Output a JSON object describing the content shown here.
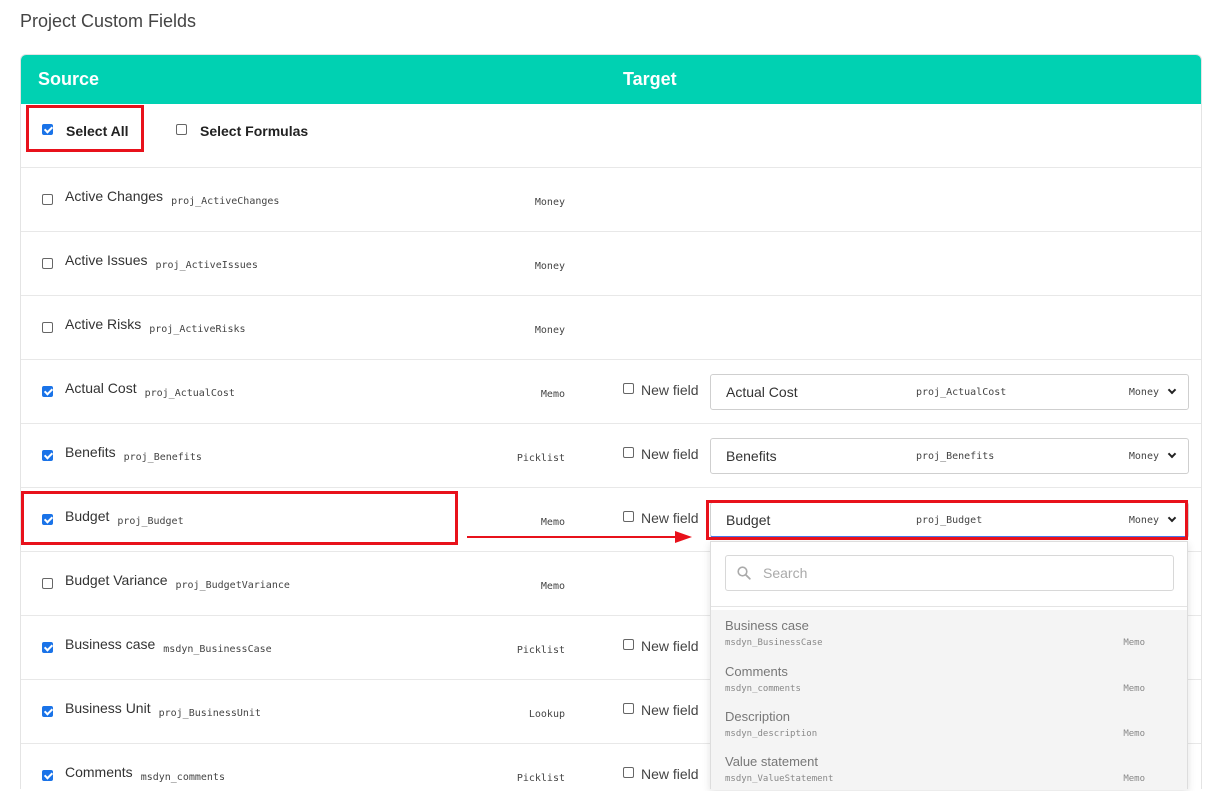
{
  "page": {
    "title": "Project Custom Fields"
  },
  "header": {
    "source": "Source",
    "target": "Target"
  },
  "select_all": {
    "label": "Select All",
    "checked": true
  },
  "select_formulas": {
    "label": "Select Formulas",
    "checked": false
  },
  "new_field_label": "New field",
  "rows": [
    {
      "name": "Active Changes",
      "code": "proj_ActiveChanges",
      "type": "Money",
      "checked": false
    },
    {
      "name": "Active Issues",
      "code": "proj_ActiveIssues",
      "type": "Money",
      "checked": false
    },
    {
      "name": "Active Risks",
      "code": "proj_ActiveRisks",
      "type": "Money",
      "checked": false
    },
    {
      "name": "Actual Cost",
      "code": "proj_ActualCost",
      "type": "Memo",
      "checked": true,
      "target": {
        "name": "Actual Cost",
        "code": "proj_ActualCost",
        "type": "Money"
      }
    },
    {
      "name": "Benefits",
      "code": "proj_Benefits",
      "type": "Picklist",
      "checked": true,
      "target": {
        "name": "Benefits",
        "code": "proj_Benefits",
        "type": "Money"
      }
    },
    {
      "name": "Budget",
      "code": "proj_Budget",
      "type": "Memo",
      "checked": true,
      "target": {
        "name": "Budget",
        "code": "proj_Budget",
        "type": "Money"
      }
    },
    {
      "name": "Budget Variance",
      "code": "proj_BudgetVariance",
      "type": "Memo",
      "checked": false
    },
    {
      "name": "Business case",
      "code": "msdyn_BusinessCase",
      "type": "Picklist",
      "checked": true
    },
    {
      "name": "Business Unit",
      "code": "proj_BusinessUnit",
      "type": "Lookup",
      "checked": true
    },
    {
      "name": "Comments",
      "code": "msdyn_comments",
      "type": "Picklist",
      "checked": true
    }
  ],
  "dropdown": {
    "search_placeholder": "Search",
    "items": [
      {
        "name": "Business case",
        "code": "msdyn_BusinessCase",
        "type": "Memo"
      },
      {
        "name": "Comments",
        "code": "msdyn_comments",
        "type": "Memo"
      },
      {
        "name": "Description",
        "code": "msdyn_description",
        "type": "Memo"
      },
      {
        "name": "Value statement",
        "code": "msdyn_ValueStatement",
        "type": "Memo"
      }
    ]
  },
  "colors": {
    "header": "#00d1b2",
    "checkbox": "#1a73e8",
    "highlight": "#e8111b"
  },
  "icons": {
    "search": "search-icon",
    "chevron": "chevron-down-icon"
  }
}
